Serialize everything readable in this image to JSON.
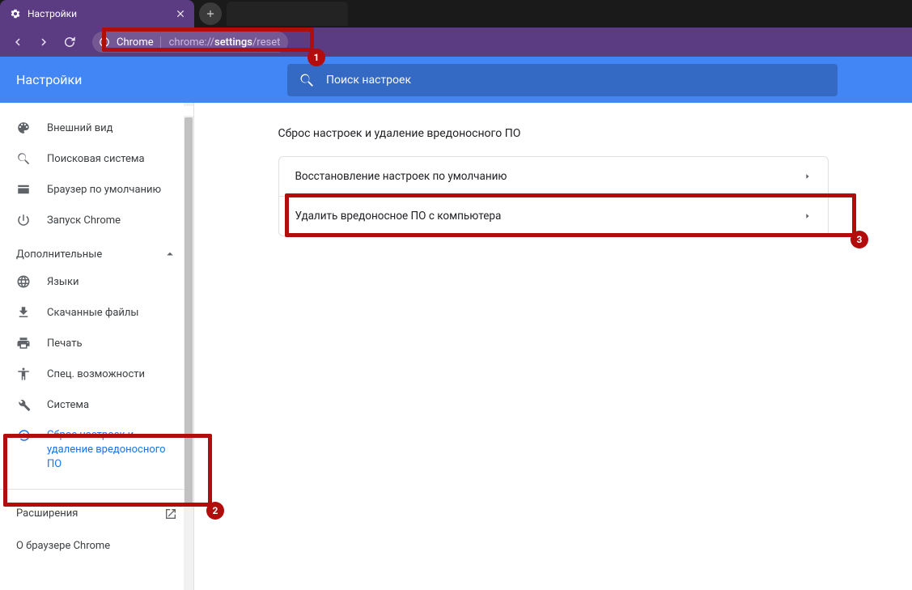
{
  "browser": {
    "tab_title": "Настройки",
    "address_label": "Chrome",
    "address_url_prefix": "chrome://",
    "address_url_highlight": "settings",
    "address_url_suffix": "/reset"
  },
  "header": {
    "title": "Настройки",
    "search_placeholder": "Поиск настроек"
  },
  "sidebar": {
    "items_top": [
      {
        "icon": "palette",
        "label": "Внешний вид"
      },
      {
        "icon": "search",
        "label": "Поисковая система"
      },
      {
        "icon": "browser",
        "label": "Браузер по умолчанию"
      },
      {
        "icon": "power",
        "label": "Запуск Chrome"
      }
    ],
    "group_label": "Дополнительные",
    "items_adv": [
      {
        "icon": "globe",
        "label": "Языки"
      },
      {
        "icon": "download",
        "label": "Скачанные файлы"
      },
      {
        "icon": "print",
        "label": "Печать"
      },
      {
        "icon": "accessibility",
        "label": "Спец. возможности"
      },
      {
        "icon": "wrench",
        "label": "Система"
      },
      {
        "icon": "restore",
        "label": "Сброс настроек и удаление вредоносного ПО",
        "active": true
      }
    ],
    "extensions": "Расширения",
    "about": "О браузере Chrome"
  },
  "main": {
    "section_title": "Сброс настроек и удаление вредоносного ПО",
    "rows": [
      "Восстановление настроек по умолчанию",
      "Удалить вредоносное ПО с компьютера"
    ]
  },
  "annotations": {
    "n1": "1",
    "n2": "2",
    "n3": "3"
  }
}
